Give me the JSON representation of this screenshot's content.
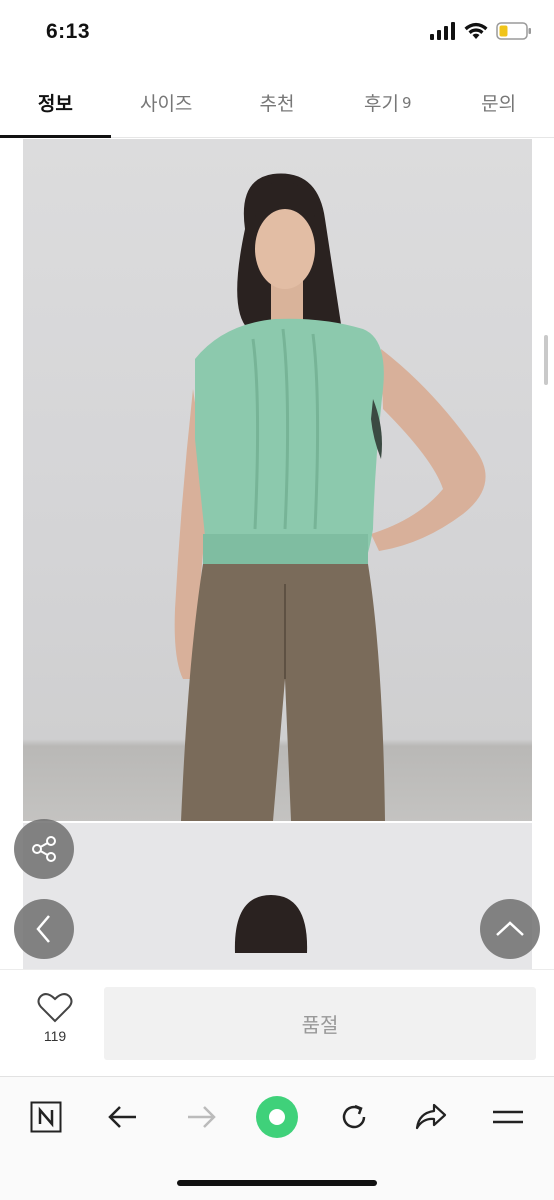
{
  "status_bar": {
    "time": "6:13"
  },
  "tabs": [
    {
      "label": "정보",
      "active": true
    },
    {
      "label": "사이즈",
      "active": false
    },
    {
      "label": "추천",
      "active": false
    },
    {
      "label": "후기",
      "count": "9",
      "active": false
    },
    {
      "label": "문의",
      "active": false
    }
  ],
  "content": {
    "images": [
      {
        "alt": "product photo 1",
        "icon": "product-photo"
      },
      {
        "alt": "product photo 2",
        "icon": "product-photo"
      }
    ],
    "floating_buttons": {
      "share_icon": "share-icon",
      "back_icon": "chevron-left-icon",
      "top_icon": "chevron-up-icon"
    }
  },
  "buy_bar": {
    "like_count": "119",
    "soldout_label": "품절"
  },
  "toolbar": {
    "icons": [
      "naver-icon",
      "arrow-left-icon",
      "arrow-right-icon",
      "green-dot-icon",
      "refresh-icon",
      "share-icon",
      "menu-icon"
    ]
  },
  "colors": {
    "accent_green": "#3fd17a",
    "soldout_bg": "#f1f1f1",
    "fab_bg": "#6e6e6e",
    "sweater": "#8cc9ad",
    "pants": "#7a6b5a"
  }
}
